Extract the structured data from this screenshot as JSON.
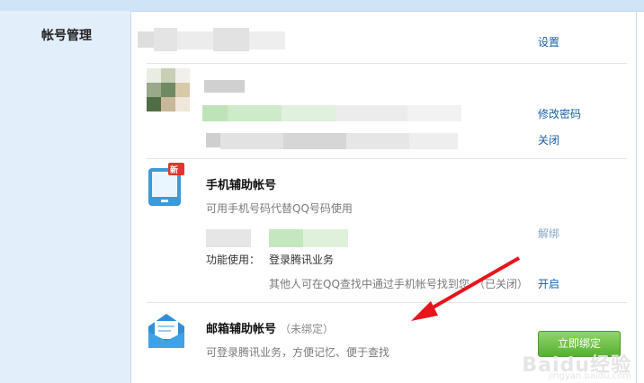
{
  "sidebar": {
    "title": "帐号管理"
  },
  "section_account": {
    "settings_link": "设置"
  },
  "section_password": {
    "change_password_link": "修改密码",
    "close_link": "关闭"
  },
  "section_phone": {
    "title": "手机辅助帐号",
    "badge": "新",
    "desc": "可用手机号码代替QQ号码使用",
    "unbind_link": "解绑",
    "func_label": "功能使用：",
    "func_value": "登录腾讯业务",
    "search_text": "其他人可在QQ查找中通过手机帐号找到您",
    "search_status": "（已关闭）",
    "enable_link": "开启"
  },
  "section_email": {
    "title": "邮箱辅助帐号",
    "status": "（未绑定）",
    "desc": "可登录腾讯业务，方便记忆、便于查找",
    "bind_button": "立即绑定"
  },
  "watermark": {
    "text": "Baidu经验",
    "sub": "jingyan.baidu.com"
  },
  "colors": {
    "link": "#1a5ea8",
    "sidebar_bg": "#e3eefb",
    "button_green": "#57b131",
    "arrow_red": "#e8141b"
  }
}
